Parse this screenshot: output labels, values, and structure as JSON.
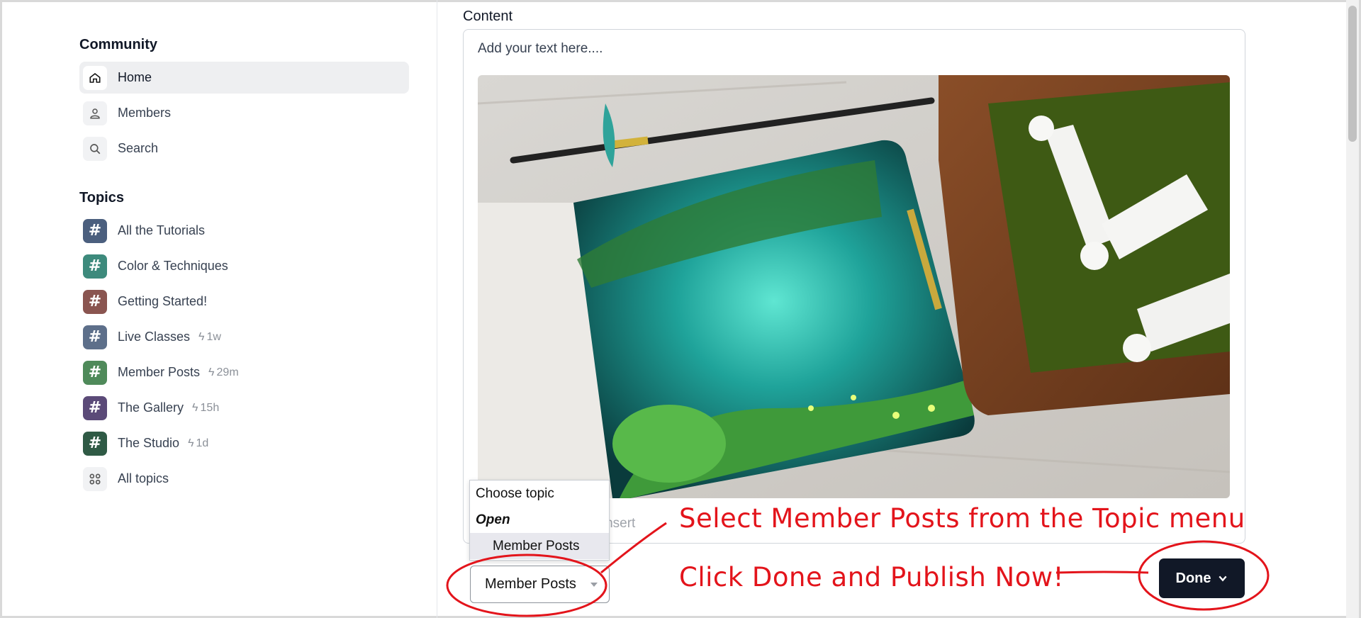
{
  "sidebar": {
    "community_title": "Community",
    "nav": [
      {
        "label": "Home",
        "icon": "home-icon"
      },
      {
        "label": "Members",
        "icon": "user-icon"
      },
      {
        "label": "Search",
        "icon": "search-icon"
      }
    ],
    "topics_title": "Topics",
    "topics": [
      {
        "label": "All the Tutorials",
        "meta": "",
        "color": "#4b5f7e"
      },
      {
        "label": "Color & Techniques",
        "meta": "",
        "color": "#3d8a7c"
      },
      {
        "label": "Getting Started!",
        "meta": "",
        "color": "#8a5550"
      },
      {
        "label": "Live Classes",
        "meta": "1w",
        "color": "#5d6f8a"
      },
      {
        "label": "Member Posts",
        "meta": "29m",
        "color": "#4f8a5a"
      },
      {
        "label": "The Gallery",
        "meta": "15h",
        "color": "#5b4a78"
      },
      {
        "label": "The Studio",
        "meta": "1d",
        "color": "#2f5a45"
      }
    ],
    "all_topics": "All topics"
  },
  "editor": {
    "label": "Content",
    "placeholder": "Add your text here....",
    "under_text": "d insert"
  },
  "topic_menu": {
    "title": "Choose topic",
    "group": "Open",
    "option": "Member Posts",
    "selected": "Member Posts"
  },
  "done_button": "Done",
  "annotations": {
    "line1": "Select Member Posts from the Topic menu",
    "line2": "Click Done and Publish Now!",
    "color": "#e3141b"
  }
}
